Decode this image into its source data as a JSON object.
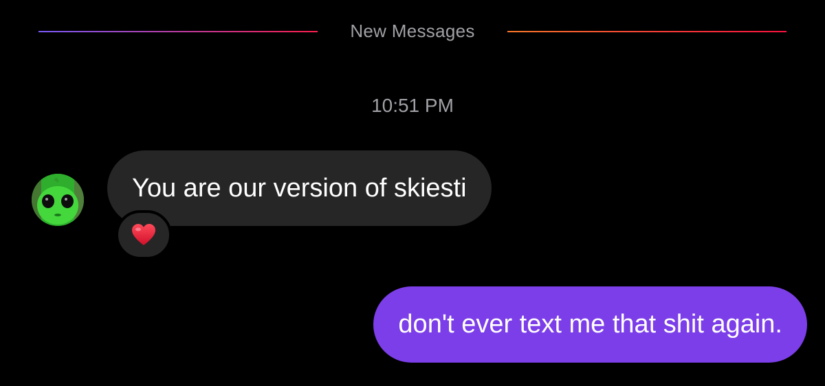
{
  "divider": {
    "label": "New Messages"
  },
  "timestamp": "10:51 PM",
  "messages": [
    {
      "direction": "incoming",
      "text": "You are our version of skiesti",
      "reaction": "heart-emoji",
      "bubble_color": "#262626"
    },
    {
      "direction": "outgoing",
      "text": "don't ever text me that shit again.",
      "bubble_color": "#7c3ee8"
    }
  ],
  "colors": {
    "background": "#000000",
    "muted_text": "#a0a0a6",
    "incoming_bubble": "#262626",
    "outgoing_bubble": "#7c3ee8",
    "reaction_heart": "#e8233a"
  }
}
